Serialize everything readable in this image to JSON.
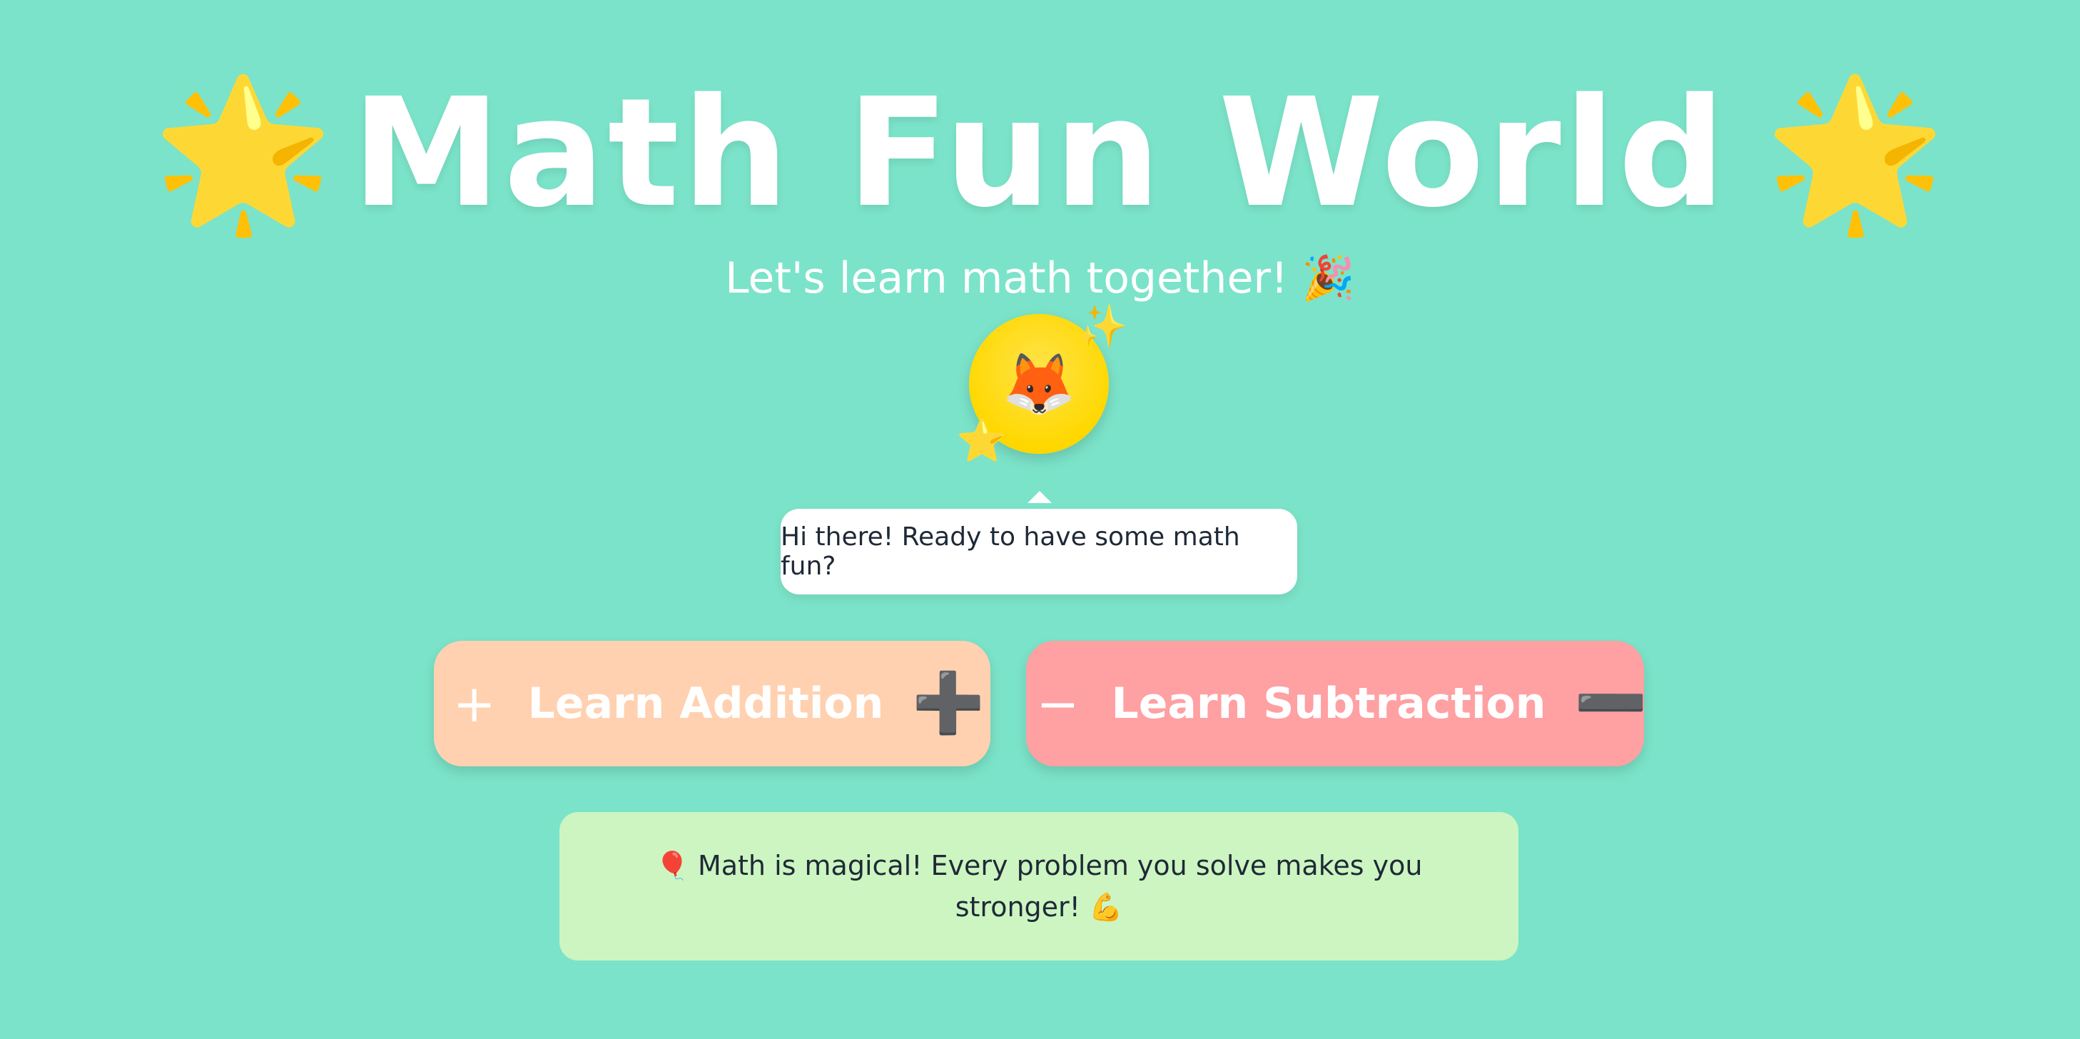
{
  "header": {
    "star_left": "🌟",
    "title": "Math Fun World",
    "star_right": "🌟",
    "subtitle": "Let's learn math together! 🎉"
  },
  "mascot": {
    "face": "🦊",
    "sparkle": "✨",
    "star": "⭐"
  },
  "speech_bubble": {
    "text": "Hi there! Ready to have some math fun?"
  },
  "buttons": {
    "addition": {
      "symbol": "+",
      "label": "Learn Addition",
      "emoji": "➕"
    },
    "subtraction": {
      "symbol": "−",
      "label": "Learn Subtraction",
      "emoji": "➖"
    }
  },
  "motivation": {
    "text": "🎈 Math is magical! Every problem you solve makes you stronger! 💪"
  },
  "colors": {
    "background": "#7be3c9",
    "addition_button": "#ffd1b0",
    "subtraction_button": "#ffa0a3",
    "mascot_circle": "#ffd800",
    "info_box": "#ccf5c1",
    "bubble": "#ffffff"
  },
  "icons": {
    "title_left": "star-icon",
    "title_right": "star-icon",
    "subtitle": "party-popper-icon",
    "mascot": "fox-icon",
    "mascot_sparkle": "sparkles-icon",
    "mascot_star": "star-icon",
    "addition_symbol": "plus-icon",
    "addition_emoji": "plus-emoji-icon",
    "subtraction_symbol": "minus-icon",
    "subtraction_emoji": "minus-emoji-icon",
    "info_left": "balloon-icon",
    "info_right": "flexed-biceps-icon"
  }
}
